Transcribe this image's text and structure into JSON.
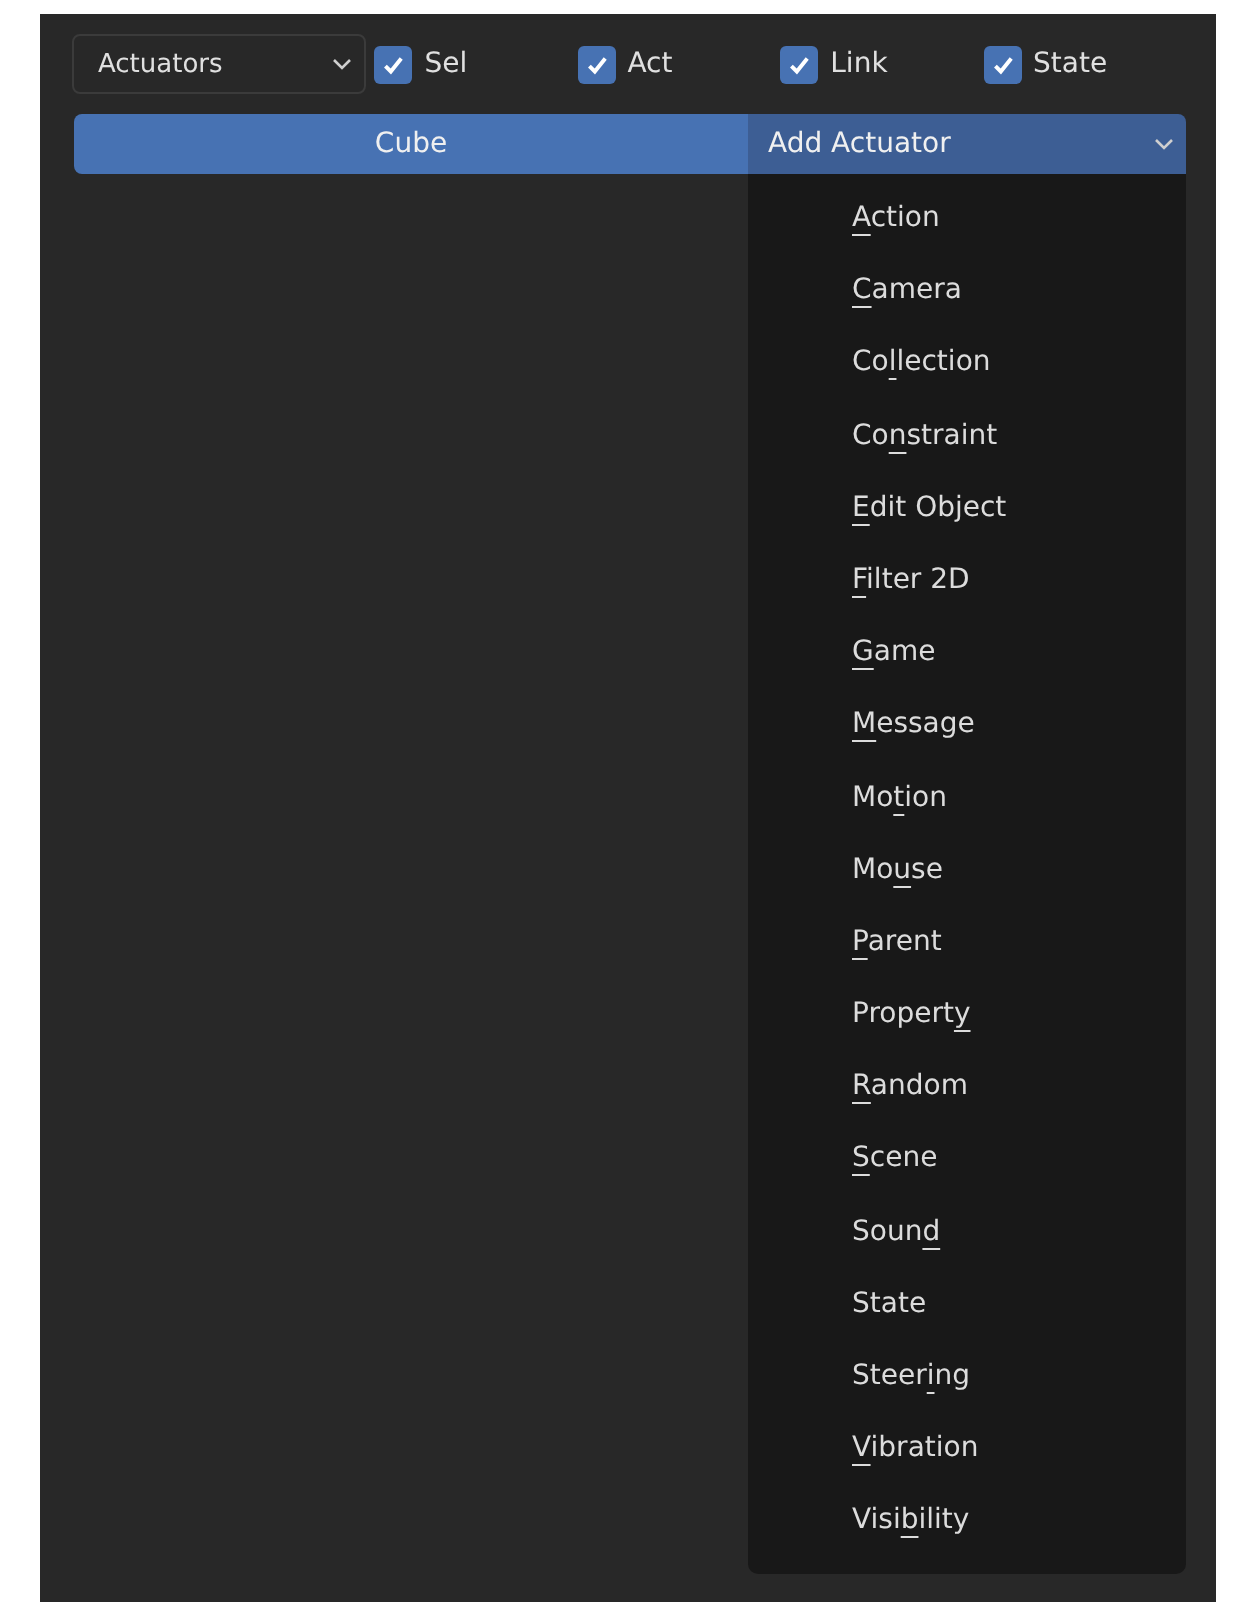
{
  "toolbar": {
    "dropdown": {
      "value": "Actuators"
    },
    "checkboxes": [
      {
        "label": "Sel",
        "checked": true
      },
      {
        "label": "Act",
        "checked": true
      },
      {
        "label": "Link",
        "checked": true
      },
      {
        "label": "State",
        "checked": true
      }
    ]
  },
  "object_button": {
    "label": "Cube"
  },
  "add_menu": {
    "label": "Add Actuator",
    "expanded": true,
    "items": [
      {
        "key": "A",
        "after": "ction"
      },
      {
        "key": "C",
        "after": "amera"
      },
      {
        "before": "Co",
        "key": "l",
        "after": "lection"
      },
      {
        "before": "Co",
        "key": "n",
        "after": "straint"
      },
      {
        "key": "E",
        "after": "dit Object"
      },
      {
        "key": "F",
        "after": "ilter 2D"
      },
      {
        "key": "G",
        "after": "ame"
      },
      {
        "key": "M",
        "after": "essage"
      },
      {
        "before": "Mo",
        "key": "t",
        "after": "ion"
      },
      {
        "before": "Mo",
        "key": "u",
        "after": "se"
      },
      {
        "key": "P",
        "after": "arent"
      },
      {
        "before": "Propert",
        "key": "y"
      },
      {
        "key": "R",
        "after": "andom"
      },
      {
        "key": "S",
        "after": "cene"
      },
      {
        "before": "Soun",
        "key": "d"
      },
      {
        "before": "State"
      },
      {
        "before": "Steer",
        "key": "i",
        "after": "ng"
      },
      {
        "key": "V",
        "after": "ibration"
      },
      {
        "before": "Visi",
        "key": "b",
        "after": "ility"
      }
    ]
  }
}
